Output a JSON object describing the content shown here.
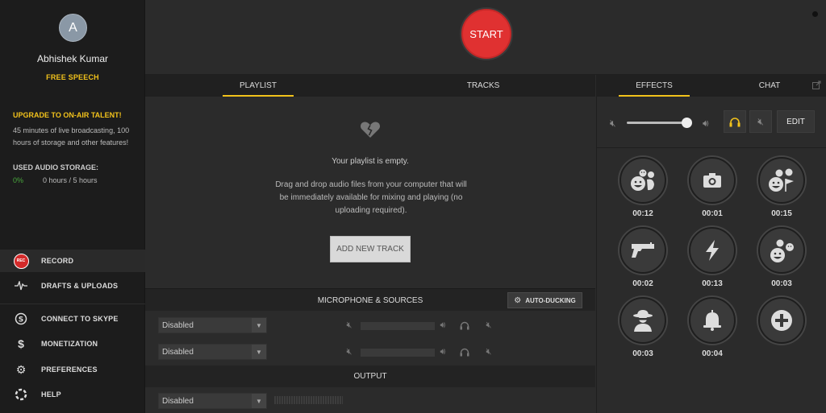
{
  "user": {
    "avatar_letter": "A",
    "name": "Abhishek Kumar",
    "plan": "FREE SPEECH"
  },
  "upgrade": {
    "title": "UPGRADE TO ON-AIR TALENT!",
    "text": "45 minutes of live broadcasting, 100 hours of storage and other features!"
  },
  "storage": {
    "title": "USED AUDIO STORAGE:",
    "percent": "0%",
    "value": "0 hours / 5 hours"
  },
  "nav": {
    "record_badge": "REC",
    "record": "RECORD",
    "drafts": "DRAFTS & UPLOADS",
    "skype": "CONNECT TO SKYPE",
    "monetization": "MONETIZATION",
    "preferences": "PREFERENCES",
    "help": "HELP"
  },
  "topbar": {
    "start_label": "START"
  },
  "playlist": {
    "tabs": [
      "PLAYLIST",
      "TRACKS"
    ],
    "empty_title": "Your playlist is empty.",
    "empty_text": "Drag and drop audio files from your computer that will be immediately available for mixing and playing (no uploading required).",
    "add_track": "ADD NEW TRACK"
  },
  "microphone": {
    "title": "MICROPHONE & SOURCES",
    "auto_ducking": "AUTO-DUCKING",
    "sources": [
      {
        "selected": "Disabled"
      },
      {
        "selected": "Disabled"
      }
    ]
  },
  "output": {
    "title": "OUTPUT",
    "selected": "Disabled"
  },
  "effects": {
    "tabs": [
      "EFFECTS",
      "CHAT"
    ],
    "edit": "EDIT",
    "volume_level": 0.93,
    "headphones_color": "#f2c21b",
    "items": [
      {
        "icon": "laugh-clap-icon",
        "time": "00:12"
      },
      {
        "icon": "camera-icon",
        "time": "00:01"
      },
      {
        "icon": "celebrate-icon",
        "time": "00:15"
      },
      {
        "icon": "gun-icon",
        "time": "00:02"
      },
      {
        "icon": "lightning-icon",
        "time": "00:13"
      },
      {
        "icon": "laughing-crowd-icon",
        "time": "00:03"
      },
      {
        "icon": "spy-icon",
        "time": "00:03"
      },
      {
        "icon": "bell-icon",
        "time": "00:04"
      },
      {
        "icon": "add-effect-icon",
        "time": ""
      }
    ]
  }
}
